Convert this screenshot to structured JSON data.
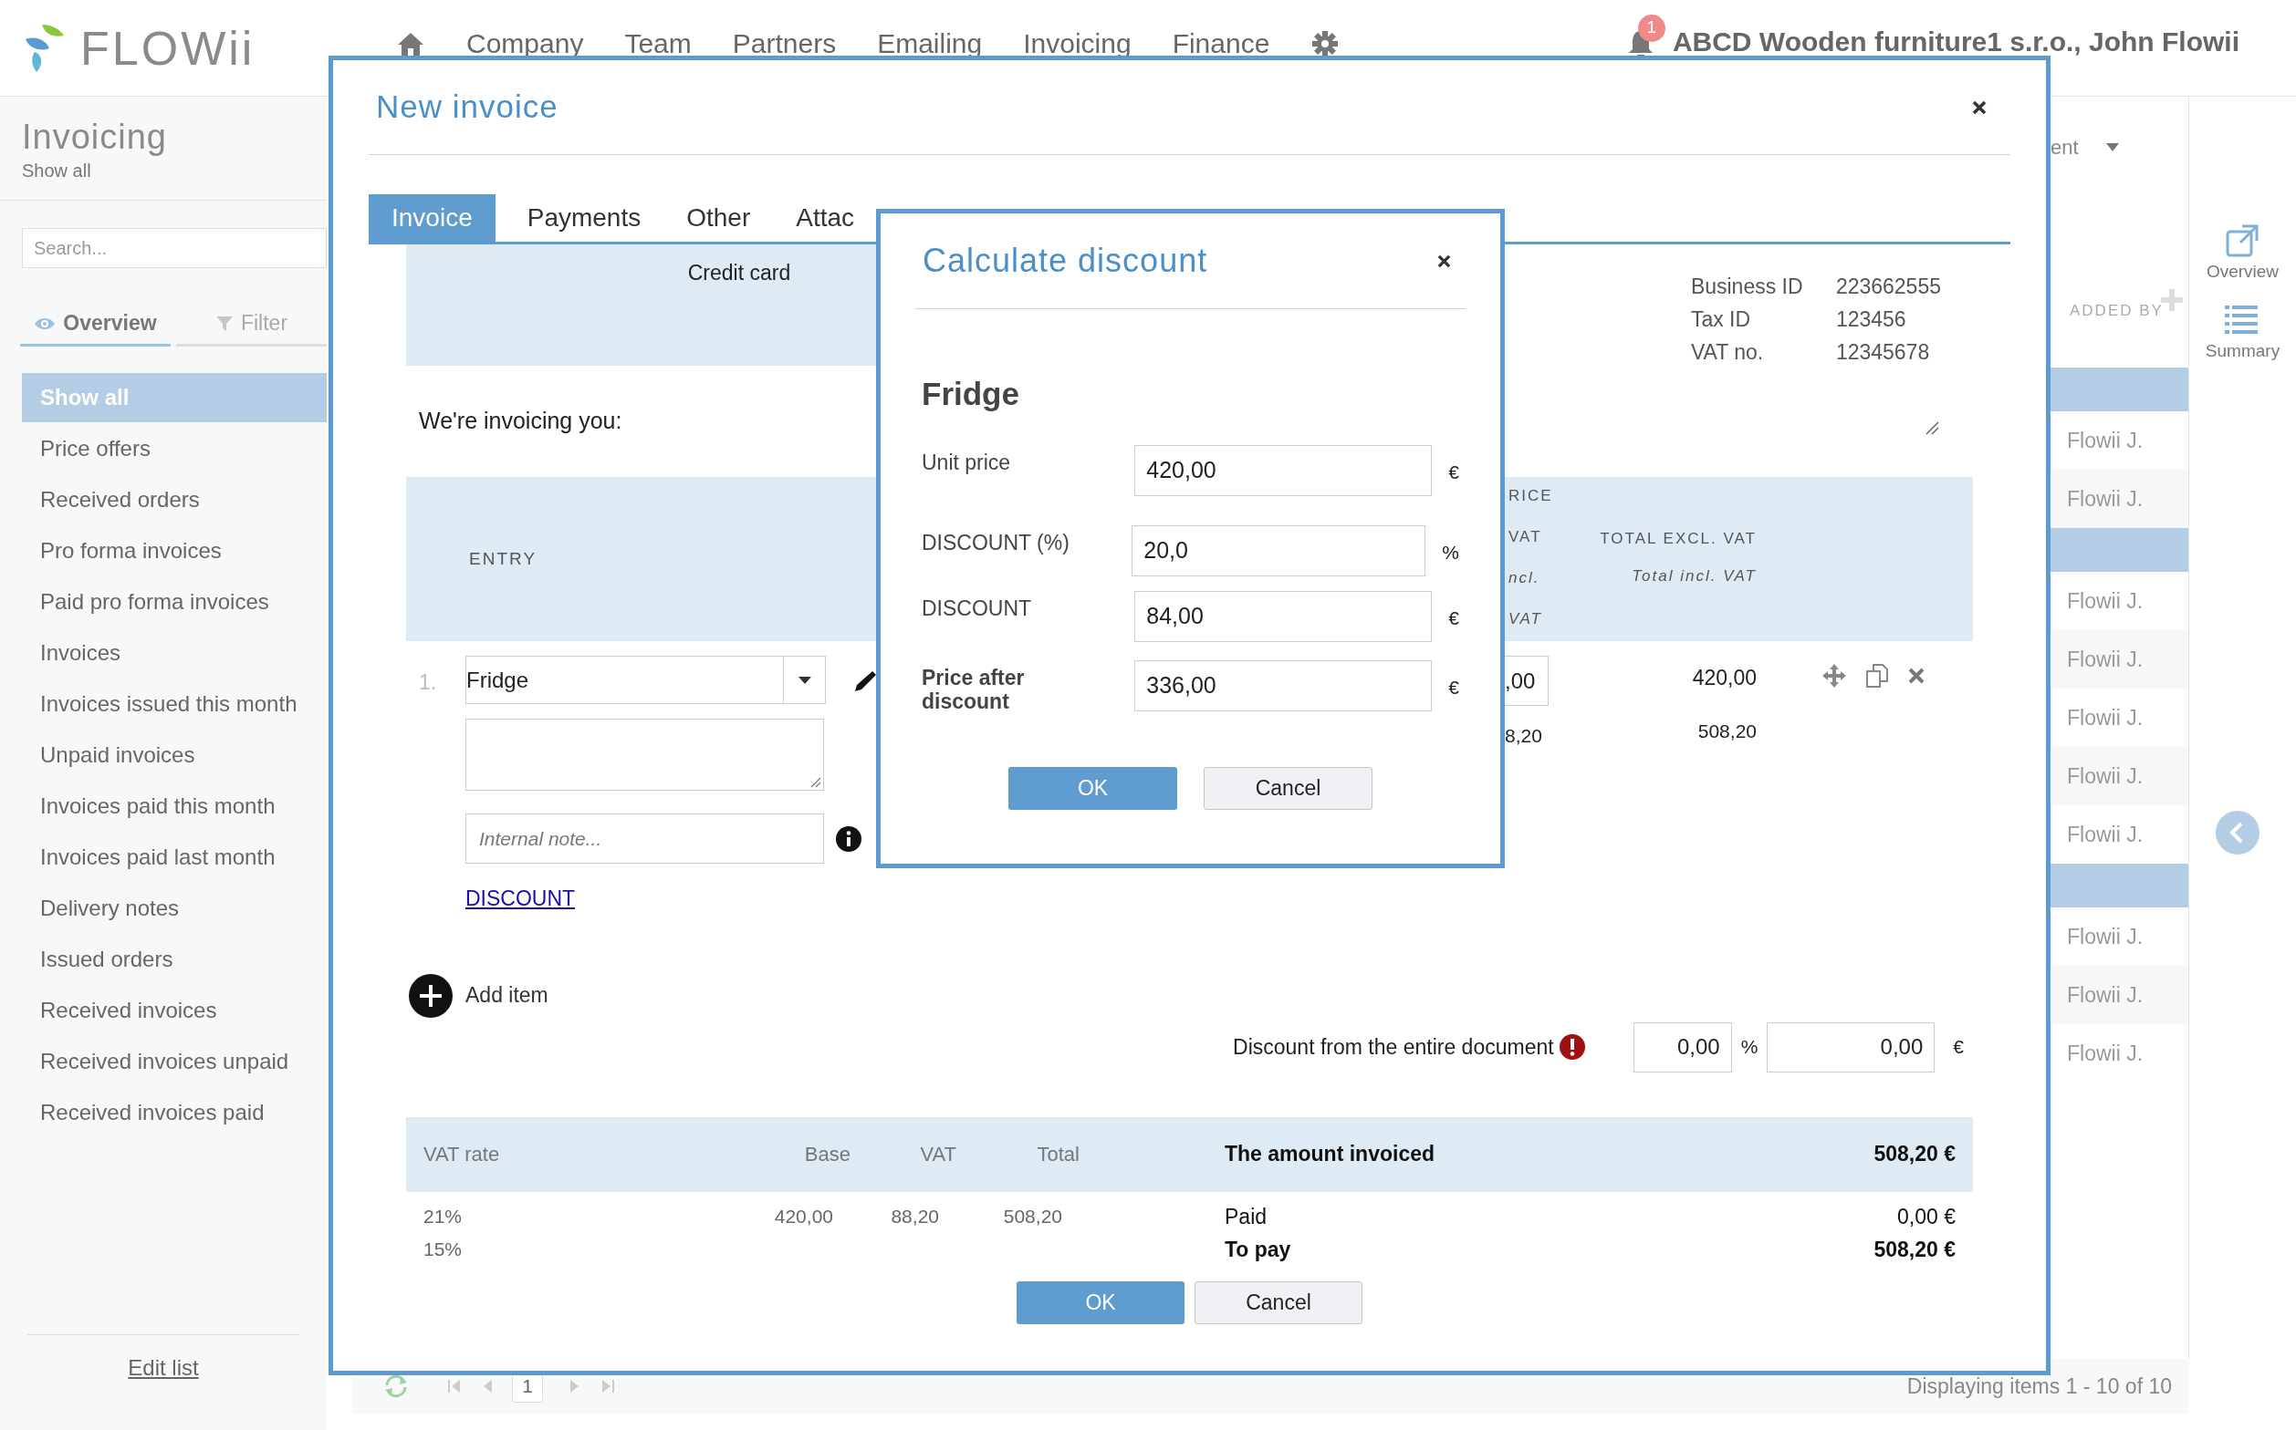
{
  "header": {
    "logo": "FLOWii",
    "nav": [
      "Company",
      "Team",
      "Partners",
      "Emailing",
      "Invoicing",
      "Finance"
    ],
    "notifications": "1",
    "account": "ABCD Wooden furniture1 s.r.o., John Flowii"
  },
  "sidebar": {
    "title": "Invoicing",
    "subtitle": "Show all",
    "search": {
      "placeholder": "Search..."
    },
    "tabs": [
      {
        "label": "Overview",
        "selected": true
      },
      {
        "label": "Filter",
        "selected": false
      }
    ],
    "items": [
      {
        "label": "Show all",
        "selected": true
      },
      {
        "label": "Price offers",
        "selected": false
      },
      {
        "label": "Received orders",
        "selected": false
      },
      {
        "label": "Pro forma invoices",
        "selected": false
      },
      {
        "label": "Paid pro forma invoices",
        "selected": false
      },
      {
        "label": "Invoices",
        "selected": false
      },
      {
        "label": "Invoices issued this month",
        "selected": false
      },
      {
        "label": "Unpaid invoices",
        "selected": false
      },
      {
        "label": "Invoices paid this month",
        "selected": false
      },
      {
        "label": "Invoices paid last month",
        "selected": false
      },
      {
        "label": "Delivery notes",
        "selected": false
      },
      {
        "label": "Issued orders",
        "selected": false
      },
      {
        "label": "Received invoices",
        "selected": false
      },
      {
        "label": "Received invoices unpaid",
        "selected": false
      },
      {
        "label": "Received invoices paid",
        "selected": false
      }
    ],
    "footer_link": "Edit list"
  },
  "list": {
    "view_dropdown": "ent",
    "column": "ADDED BY",
    "rows": [
      {
        "kind": "group"
      },
      {
        "kind": "record",
        "added_by": "Flowii J."
      },
      {
        "kind": "record",
        "added_by": "Flowii J."
      },
      {
        "kind": "group"
      },
      {
        "kind": "record",
        "added_by": "Flowii J."
      },
      {
        "kind": "record",
        "added_by": "Flowii J."
      },
      {
        "kind": "record",
        "added_by": "Flowii J."
      },
      {
        "kind": "record",
        "added_by": "Flowii J."
      },
      {
        "kind": "record",
        "added_by": "Flowii J."
      },
      {
        "kind": "group"
      },
      {
        "kind": "record",
        "added_by": "Flowii J."
      },
      {
        "kind": "record",
        "added_by": "Flowii J."
      },
      {
        "kind": "record",
        "added_by": "Flowii J."
      }
    ]
  },
  "right_rail": [
    "Overview",
    "Summary"
  ],
  "pagination": {
    "page": "1",
    "summary": "Displaying items 1 - 10 of 10"
  },
  "invoice_dialog": {
    "title": "New invoice",
    "tabs": [
      {
        "label": "Invoice",
        "selected": true
      },
      {
        "label": "Payments",
        "selected": false
      },
      {
        "label": "Other",
        "selected": false
      },
      {
        "label": "Attac",
        "selected": false
      }
    ],
    "payment_method": "Credit card",
    "company_ids": [
      {
        "label": "Business ID",
        "value": "223662555"
      },
      {
        "label": "Tax ID",
        "value": "123456"
      },
      {
        "label": "VAT no.",
        "value": "12345678"
      }
    ],
    "intro": "We're invoicing you:",
    "columns": {
      "entry": "ENTRY",
      "price_fragments": [
        {
          "text": "RICE",
          "italic": false
        },
        {
          "text": "VAT",
          "italic": false
        },
        {
          "text": "ncl.",
          "italic": true
        },
        {
          "text": "VAT",
          "italic": true
        }
      ],
      "total_excl": "TOTAL EXCL. VAT",
      "total_incl": "Total incl. VAT"
    },
    "items": [
      {
        "number": "1.",
        "name": "Fridge",
        "note": {
          "placeholder": "Internal note..."
        },
        "discount_link": "DISCOUNT",
        "price_fragment": ",00",
        "price_incl_fragment": "8,20",
        "total_excl": "420,00",
        "total_incl": "508,20"
      }
    ],
    "add_item": "Add item",
    "document_discount": {
      "label": "Discount from the entire document",
      "percent": "0,00",
      "percent_unit": "%",
      "amount": "0,00",
      "currency": "€"
    },
    "vat_summary": {
      "columns": [
        "VAT rate",
        "Base",
        "VAT",
        "Total"
      ],
      "rows": [
        {
          "rate": "21%",
          "base": "420,00",
          "vat": "88,20",
          "total": "508,20"
        },
        {
          "rate": "15%"
        }
      ]
    },
    "amount_invoiced": {
      "label": "The amount invoiced",
      "value": "508,20 €"
    },
    "totals": [
      {
        "label": "Paid",
        "value": "0,00 €",
        "bold": false
      },
      {
        "label": "To pay",
        "value": "508,20 €",
        "bold": true
      }
    ],
    "buttons": [
      "OK",
      "Cancel"
    ]
  },
  "discount_dialog": {
    "title": "Calculate discount",
    "item": "Fridge",
    "fields": [
      {
        "label": "Unit price",
        "value": "420,00",
        "unit": "€",
        "bold": false
      },
      {
        "label": "DISCOUNT (%)",
        "value": "20,0",
        "unit": "%",
        "bold": false
      },
      {
        "label": "DISCOUNT",
        "value": "84,00",
        "unit": "€",
        "bold": false
      },
      {
        "label": "Price after discount",
        "value": "336,00",
        "unit": "€",
        "bold": true
      }
    ],
    "buttons": [
      "OK",
      "Cancel"
    ]
  }
}
